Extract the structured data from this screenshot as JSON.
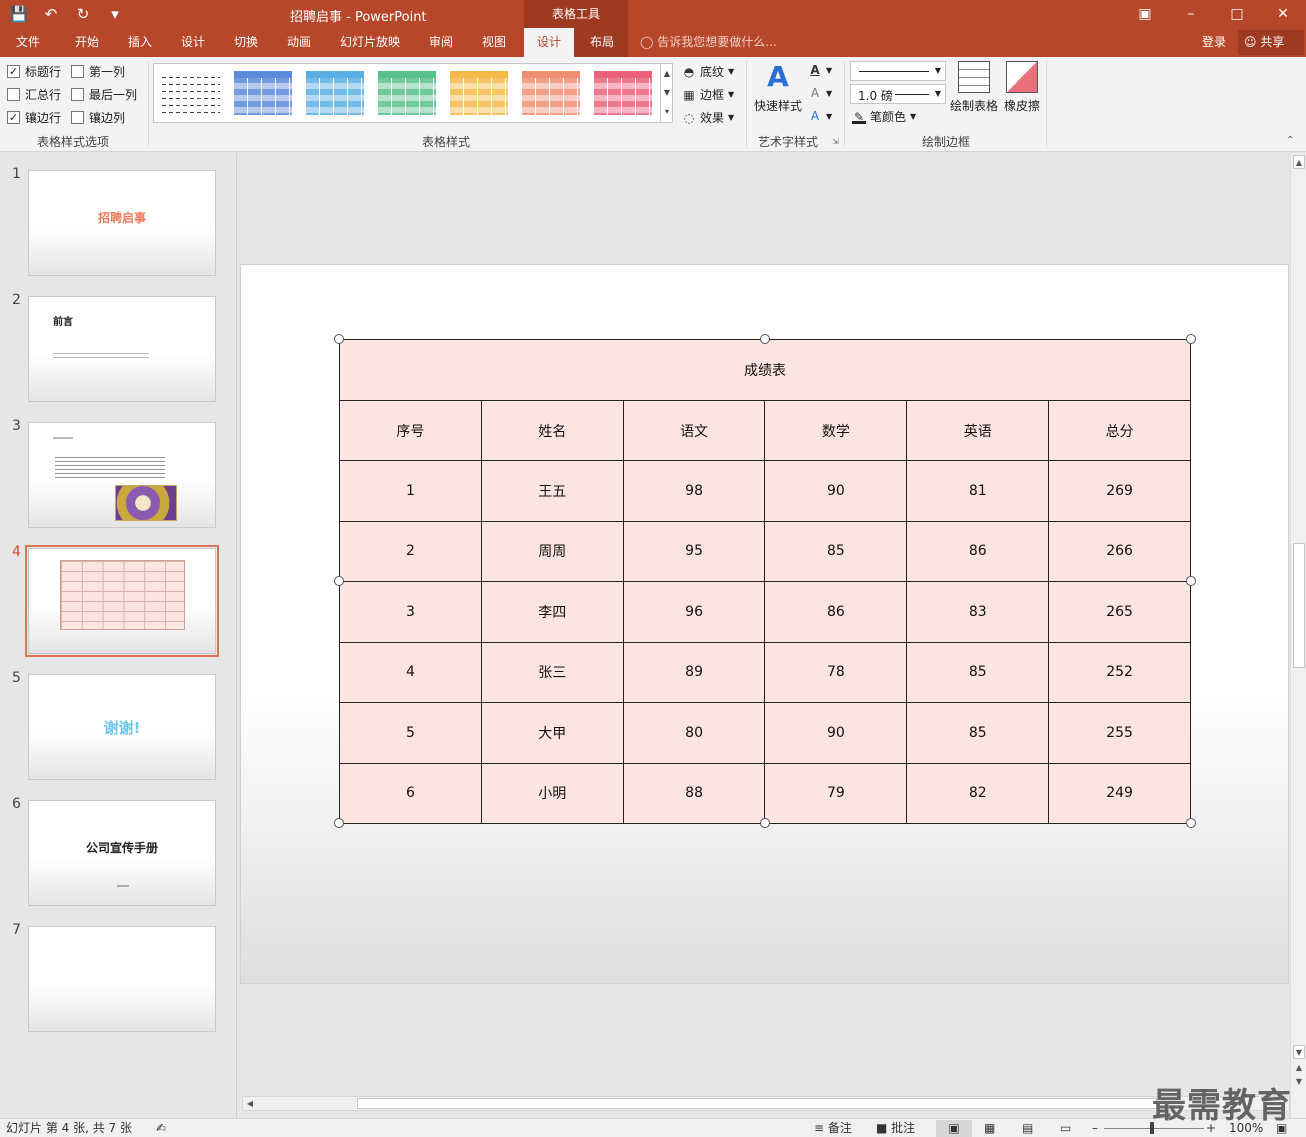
{
  "titlebar": {
    "title": "招聘启事 - PowerPoint",
    "tool_context": "表格工具",
    "qat": [
      "save-icon",
      "undo-icon",
      "redo-icon",
      "customize-icon"
    ]
  },
  "tabs": [
    {
      "label": "文件",
      "active": false
    },
    {
      "label": "开始",
      "active": false
    },
    {
      "label": "插入",
      "active": false
    },
    {
      "label": "设计",
      "active": false
    },
    {
      "label": "切换",
      "active": false
    },
    {
      "label": "动画",
      "active": false
    },
    {
      "label": "幻灯片放映",
      "active": false
    },
    {
      "label": "审阅",
      "active": false
    },
    {
      "label": "视图",
      "active": false
    },
    {
      "label": "设计",
      "active": true
    },
    {
      "label": "布局",
      "active": false
    }
  ],
  "tellme": "告诉我您想要做什么...",
  "login": "登录",
  "share": "共享",
  "ribbon": {
    "style_options": {
      "header_row": {
        "label": "标题行",
        "checked": true
      },
      "first_column": {
        "label": "第一列",
        "checked": false
      },
      "total_row": {
        "label": "汇总行",
        "checked": false
      },
      "last_column": {
        "label": "最后一列",
        "checked": false
      },
      "banded_rows": {
        "label": "镶边行",
        "checked": true
      },
      "banded_columns": {
        "label": "镶边列",
        "checked": false
      },
      "group_label": "表格样式选项"
    },
    "table_styles": {
      "group_label": "表格样式",
      "swatch_colors": [
        "#ffffff",
        "#5b8bd9",
        "#5aaee3",
        "#58c08a",
        "#f5b94a",
        "#ef8f72",
        "#e9627a"
      ],
      "shading": "底纹",
      "borders": "边框",
      "effects": "效果"
    },
    "wordart": {
      "quick_styles": "快速样式",
      "group_label": "艺术字样式"
    },
    "draw_borders": {
      "pen_weight": "1.0 磅",
      "pen_color": "笔颜色",
      "draw_table": "绘制表格",
      "eraser": "橡皮擦",
      "group_label": "绘制边框"
    }
  },
  "thumbnails": [
    {
      "num": "1",
      "title": "招聘启事",
      "selected": false
    },
    {
      "num": "2",
      "title": "前言",
      "selected": false
    },
    {
      "num": "3",
      "title": "",
      "selected": false
    },
    {
      "num": "4",
      "title": "",
      "selected": true
    },
    {
      "num": "5",
      "title": "谢谢!",
      "selected": false
    },
    {
      "num": "6",
      "title": "公司宣传手册",
      "selected": false
    },
    {
      "num": "7",
      "title": "",
      "selected": false
    }
  ],
  "table": {
    "caption": "成绩表",
    "headers": [
      "序号",
      "姓名",
      "语文",
      "数学",
      "英语",
      "总分"
    ],
    "rows": [
      [
        "1",
        "王五",
        "98",
        "90",
        "81",
        "269"
      ],
      [
        "2",
        "周周",
        "95",
        "85",
        "86",
        "266"
      ],
      [
        "3",
        "李四",
        "96",
        "86",
        "83",
        "265"
      ],
      [
        "4",
        "张三",
        "89",
        "78",
        "85",
        "252"
      ],
      [
        "5",
        "大甲",
        "80",
        "90",
        "85",
        "255"
      ],
      [
        "6",
        "小明",
        "88",
        "79",
        "82",
        "249"
      ]
    ]
  },
  "statusbar": {
    "slide_info": "幻灯片 第 4 张, 共 7 张",
    "notes": "备注",
    "comments": "批注",
    "zoom": "100%"
  },
  "watermark": "最需教育"
}
